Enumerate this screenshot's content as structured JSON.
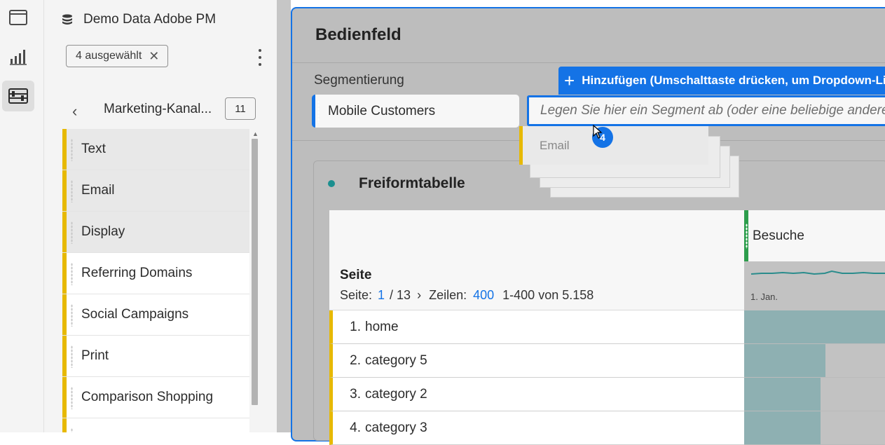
{
  "rail": {
    "icons": [
      "panel-icon",
      "visualization-icon",
      "components-icon"
    ]
  },
  "sidebar": {
    "dataset_title": "Demo Data Adobe PM",
    "filter_chip": "4 ausgewählt",
    "filter_chip_close": "✕",
    "crumb": "Marketing-Kanal...",
    "count": "11",
    "back_glyph": "‹",
    "items": [
      {
        "label": "Text",
        "selected": true
      },
      {
        "label": "Email",
        "selected": true
      },
      {
        "label": "Display",
        "selected": true
      },
      {
        "label": "Referring Domains",
        "selected": false
      },
      {
        "label": "Social Campaigns",
        "selected": false
      },
      {
        "label": "Print",
        "selected": false
      },
      {
        "label": "Comparison Shopping",
        "selected": false
      },
      {
        "label": "",
        "selected": false
      }
    ]
  },
  "panel": {
    "title": "Bedienfeld",
    "segment_label": "Segmentierung",
    "segment_chip": "Mobile Customers",
    "drop_placeholder": "Legen Sie hier ein Segment ab (oder eine beliebige andere Komp",
    "add_banner_plus": "+",
    "add_banner": "Hinzufügen (Umschalttaste drücken, um Dropdown-Liste",
    "drag_ghost": "Email",
    "drag_count": "4"
  },
  "freeform": {
    "title": "Freiformtabelle",
    "metric": "Besuche",
    "dimension": "Seite",
    "pager": {
      "page_label": "Seite:",
      "page": "1",
      "page_total": "/ 13",
      "next": "›",
      "rows_label": "Zeilen:",
      "rows": "400",
      "range": "1-400 von 5.158"
    },
    "sparkline_label": "1. Jan.",
    "rows": [
      {
        "num": "1.",
        "label": "home",
        "fill": 1.0
      },
      {
        "num": "2.",
        "label": "category 5",
        "fill": 0.55
      },
      {
        "num": "3.",
        "label": "category 2",
        "fill": 0.52
      },
      {
        "num": "4.",
        "label": "category 3",
        "fill": 0.52
      }
    ]
  },
  "colors": {
    "accent": "#1473e6",
    "category_bar": "#e7b900",
    "metric_bar": "#2d9d4c",
    "viz_dot": "#1b8f8f",
    "cell_fill": "#8eb0b2"
  }
}
